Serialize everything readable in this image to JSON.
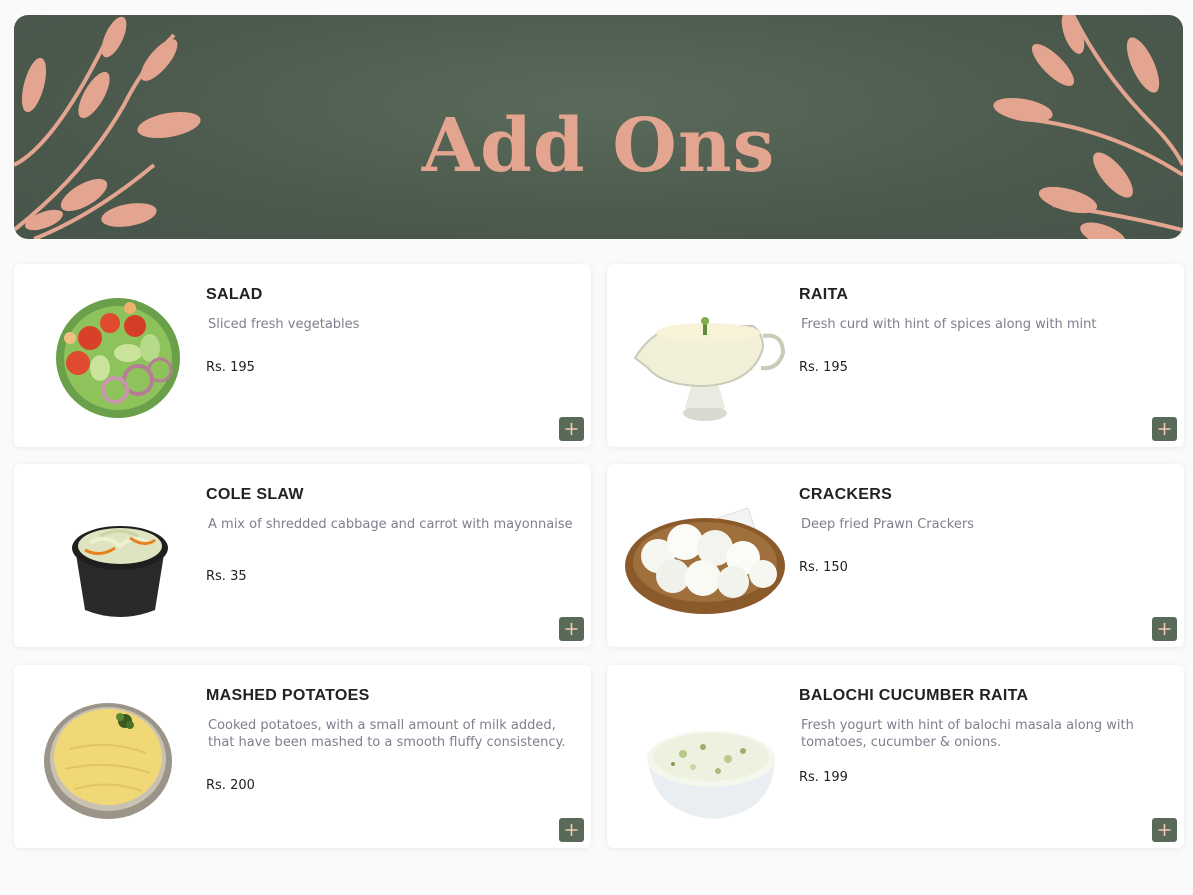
{
  "banner": {
    "title": "Add Ons"
  },
  "colors": {
    "banner_bg": "#4f5d50",
    "accent_peach": "#e3a58f",
    "add_button": "#5a6a58",
    "description_text": "#7d7f8e"
  },
  "items": [
    {
      "name": "SALAD",
      "description": "Sliced fresh vegetables",
      "price": "Rs. 195",
      "image": "salad-plate"
    },
    {
      "name": "RAITA",
      "description": "Fresh curd with hint of spices along with mint",
      "price": "Rs. 195",
      "image": "raita-gravy-boat"
    },
    {
      "name": "COLE SLAW",
      "description": "A mix of shredded cabbage and carrot with mayonnaise",
      "price": "Rs. 35",
      "image": "coleslaw-bowl"
    },
    {
      "name": "CRACKERS",
      "description": "Deep fried Prawn Crackers",
      "price": "Rs. 150",
      "image": "prawn-crackers-basket"
    },
    {
      "name": "MASHED POTATOES",
      "description": "Cooked potatoes, with a small amount of milk added, that have been mashed to a smooth fluffy consistency.",
      "price": "Rs. 200",
      "image": "mashed-potatoes-bowl"
    },
    {
      "name": "BALOCHI CUCUMBER RAITA",
      "description": "Fresh yogurt with hint of balochi masala along with tomatoes, cucumber & onions.",
      "price": "Rs. 199",
      "image": "cucumber-raita-bowl"
    }
  ],
  "icons": {
    "add": "plus-icon",
    "decoration": "leaf-branch"
  }
}
